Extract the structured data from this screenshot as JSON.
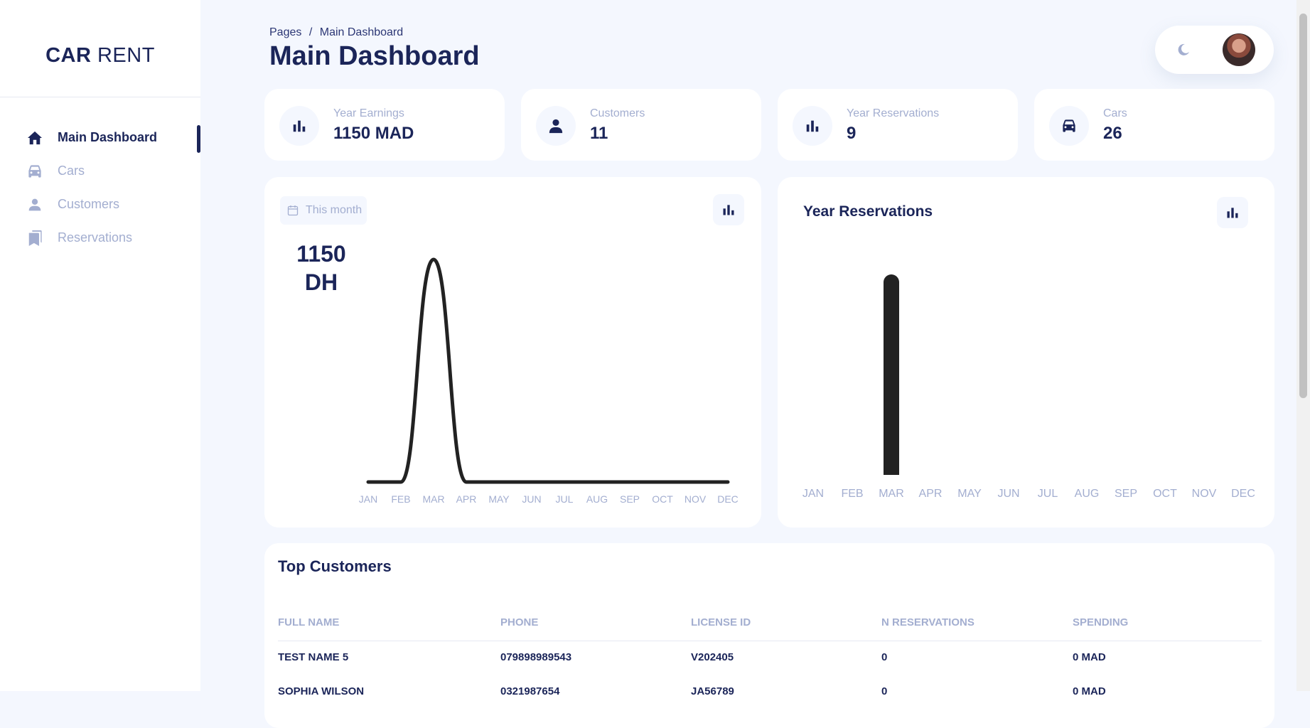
{
  "app": {
    "logo_bold": "CAR",
    "logo_light": "RENT"
  },
  "sidebar": {
    "items": [
      {
        "label": "Main Dashboard",
        "icon": "home-icon",
        "active": true
      },
      {
        "label": "Cars",
        "icon": "car-icon",
        "active": false
      },
      {
        "label": "Customers",
        "icon": "person-icon",
        "active": false
      },
      {
        "label": "Reservations",
        "icon": "bookmark-icon",
        "active": false
      }
    ]
  },
  "header": {
    "breadcrumb": [
      "Pages",
      "/",
      "Main Dashboard"
    ],
    "title": "Main Dashboard"
  },
  "stats": [
    {
      "label": "Year Earnings",
      "value": "1150 MAD",
      "icon": "bar-chart-icon"
    },
    {
      "label": "Customers",
      "value": "11",
      "icon": "person-icon"
    },
    {
      "label": "Year Reservations",
      "value": "9",
      "icon": "bar-chart-icon"
    },
    {
      "label": "Cars",
      "value": "26",
      "icon": "car-icon"
    }
  ],
  "earnings_card": {
    "period": "This month",
    "value_line1": "1150",
    "value_line2": "DH"
  },
  "reservations_card": {
    "title": "Year Reservations"
  },
  "chart_data": [
    {
      "type": "line",
      "title": "",
      "categories": [
        "JAN",
        "FEB",
        "MAR",
        "APR",
        "MAY",
        "JUN",
        "JUL",
        "AUG",
        "SEP",
        "OCT",
        "NOV",
        "DEC"
      ],
      "values": [
        0,
        0,
        1150,
        0,
        0,
        0,
        0,
        0,
        0,
        0,
        0,
        0
      ],
      "smooth": true,
      "color": "#222222",
      "grid": false
    },
    {
      "type": "bar",
      "title": "Year Reservations",
      "categories": [
        "JAN",
        "FEB",
        "MAR",
        "APR",
        "MAY",
        "JUN",
        "JUL",
        "AUG",
        "SEP",
        "OCT",
        "NOV",
        "DEC"
      ],
      "values": [
        0,
        0,
        9,
        0,
        0,
        0,
        0,
        0,
        0,
        0,
        0,
        0
      ],
      "color": "#222222",
      "grid": false
    }
  ],
  "top_customers": {
    "title": "Top Customers",
    "columns": [
      "FULL NAME",
      "PHONE",
      "LICENSE ID",
      "N RESERVATIONS",
      "SPENDING"
    ],
    "rows": [
      [
        "TEST NAME 5",
        "079898989543",
        "V202405",
        "0",
        "0 MAD"
      ],
      [
        "SOPHIA WILSON",
        "0321987654",
        "JA56789",
        "0",
        "0 MAD"
      ]
    ]
  },
  "colors": {
    "primary": "#1b2559",
    "muted": "#a3aed0",
    "background": "#f4f7fe",
    "chart": "#222222"
  }
}
